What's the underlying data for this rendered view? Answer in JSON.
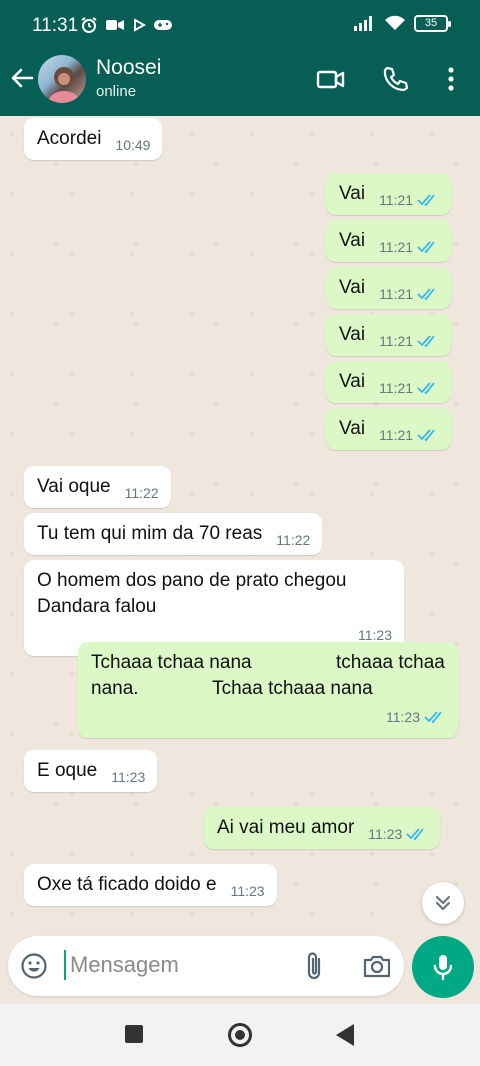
{
  "status_bar": {
    "time": "11:31",
    "battery": "35"
  },
  "header": {
    "contact_name": "Noosei",
    "contact_status": "online"
  },
  "messages": [
    {
      "text": "Acordei",
      "time": "10:49"
    },
    {
      "text": "Vai",
      "time": "11:21"
    },
    {
      "text": "Vai",
      "time": "11:21"
    },
    {
      "text": "Vai",
      "time": "11:21"
    },
    {
      "text": "Vai",
      "time": "11:21"
    },
    {
      "text": "Vai",
      "time": "11:21"
    },
    {
      "text": "Vai",
      "time": "11:21"
    },
    {
      "text": "Vai oque",
      "time": "11:22"
    },
    {
      "text": "Tu tem qui mim da 70 reas",
      "time": "11:22"
    },
    {
      "text": "O homem dos pano de prato chegou Dandara falou",
      "time": "11:23"
    },
    {
      "text": "Tchaaa tchaa nana                tchaaa tchaa nana.              Tchaa tchaaa nana",
      "time": "11:23"
    },
    {
      "text": "E oque",
      "time": "11:23"
    },
    {
      "text": "Ai vai meu amor",
      "time": "11:23"
    },
    {
      "text": "Oxe tá ficado doido e",
      "time": "11:23"
    }
  ],
  "input": {
    "placeholder": "Mensagem"
  },
  "colors": {
    "header": "#075e54",
    "outgoing_bubble": "#dcf8c6",
    "incoming_bubble": "#ffffff",
    "accent": "#00a884",
    "read_ticks": "#34b7f1"
  }
}
